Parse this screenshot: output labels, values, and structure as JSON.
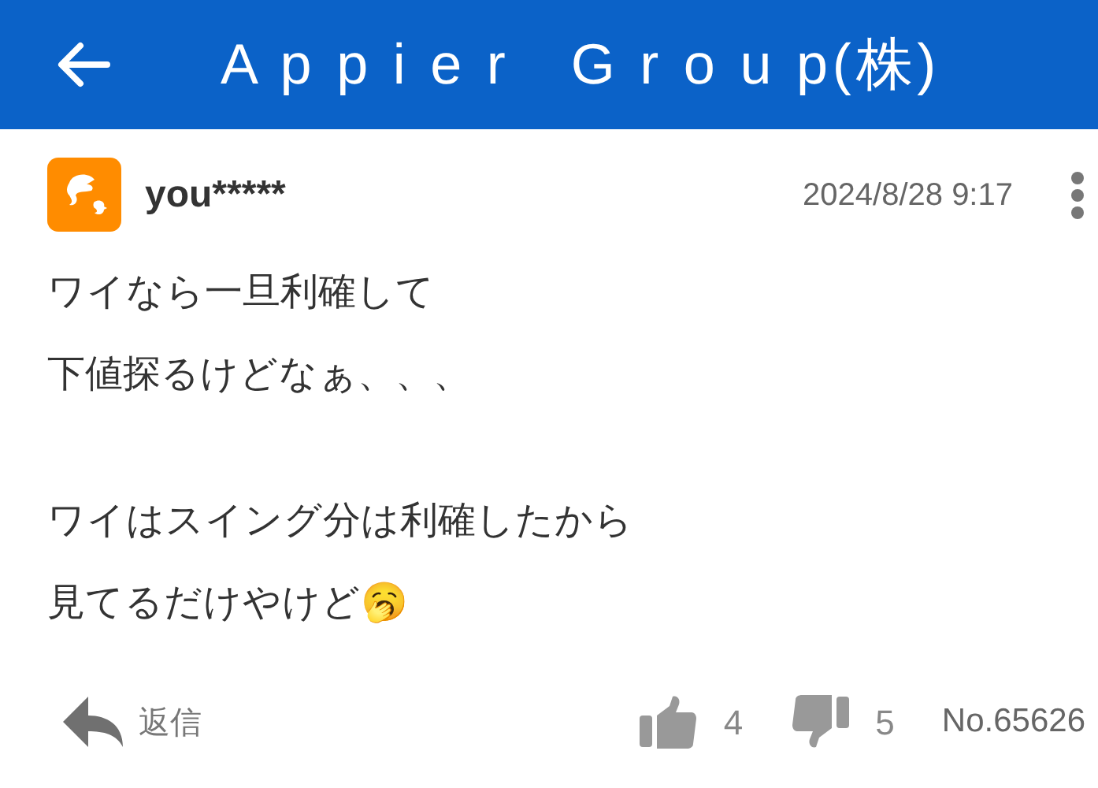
{
  "header": {
    "title": "A p p i e r   G r o u p(株)"
  },
  "post": {
    "user": "you*****",
    "time": "2024/8/28 9:17",
    "paragraphs": [
      [
        "ワイなら一旦利確して",
        "下値探るけどなぁ、、、"
      ],
      [
        "ワイはスイング分は利確したから",
        "見てるだけやけど🥱"
      ]
    ],
    "reply": "返信",
    "likes": "4",
    "dislikes": "5",
    "number": "No.65626"
  }
}
